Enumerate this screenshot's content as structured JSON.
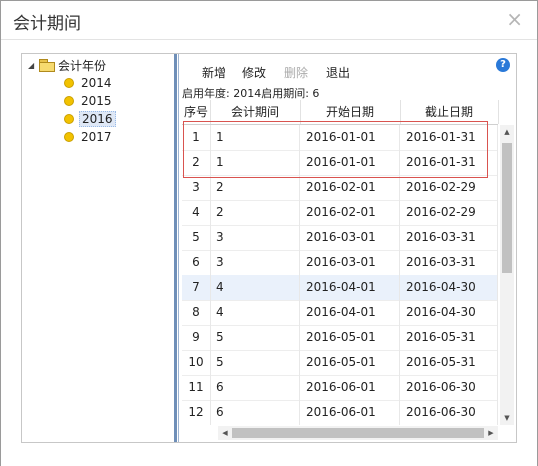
{
  "dialog": {
    "title": "会计期间",
    "close_icon": "×"
  },
  "tree": {
    "root_label": "会计年份",
    "years": [
      "2014",
      "2015",
      "2016",
      "2017"
    ],
    "selected": "2016"
  },
  "toolbar": {
    "add_label": "新增",
    "edit_label": "修改",
    "delete_label": "删除",
    "exit_label": "退出",
    "help_icon": "?"
  },
  "info": {
    "text": "启用年度: 2014启用期间: 6"
  },
  "table": {
    "columns": [
      "序号",
      "会计期间",
      "开始日期",
      "截止日期"
    ],
    "rows": [
      {
        "seq": "1",
        "period": "1",
        "start": "2016-01-01",
        "end": "2016-01-31"
      },
      {
        "seq": "2",
        "period": "1",
        "start": "2016-01-01",
        "end": "2016-01-31"
      },
      {
        "seq": "3",
        "period": "2",
        "start": "2016-02-01",
        "end": "2016-02-29"
      },
      {
        "seq": "4",
        "period": "2",
        "start": "2016-02-01",
        "end": "2016-02-29"
      },
      {
        "seq": "5",
        "period": "3",
        "start": "2016-03-01",
        "end": "2016-03-31"
      },
      {
        "seq": "6",
        "period": "3",
        "start": "2016-03-01",
        "end": "2016-03-31"
      },
      {
        "seq": "7",
        "period": "4",
        "start": "2016-04-01",
        "end": "2016-04-30"
      },
      {
        "seq": "8",
        "period": "4",
        "start": "2016-04-01",
        "end": "2016-04-30"
      },
      {
        "seq": "9",
        "period": "5",
        "start": "2016-05-01",
        "end": "2016-05-31"
      },
      {
        "seq": "10",
        "period": "5",
        "start": "2016-05-01",
        "end": "2016-05-31"
      },
      {
        "seq": "11",
        "period": "6",
        "start": "2016-06-01",
        "end": "2016-06-30"
      },
      {
        "seq": "12",
        "period": "6",
        "start": "2016-06-01",
        "end": "2016-06-30"
      }
    ],
    "highlighted_row": "7"
  },
  "colors": {
    "highlight_box": "#d9534f",
    "splitter": "#6f8fb8",
    "row_hover": "#eaf1fb"
  }
}
